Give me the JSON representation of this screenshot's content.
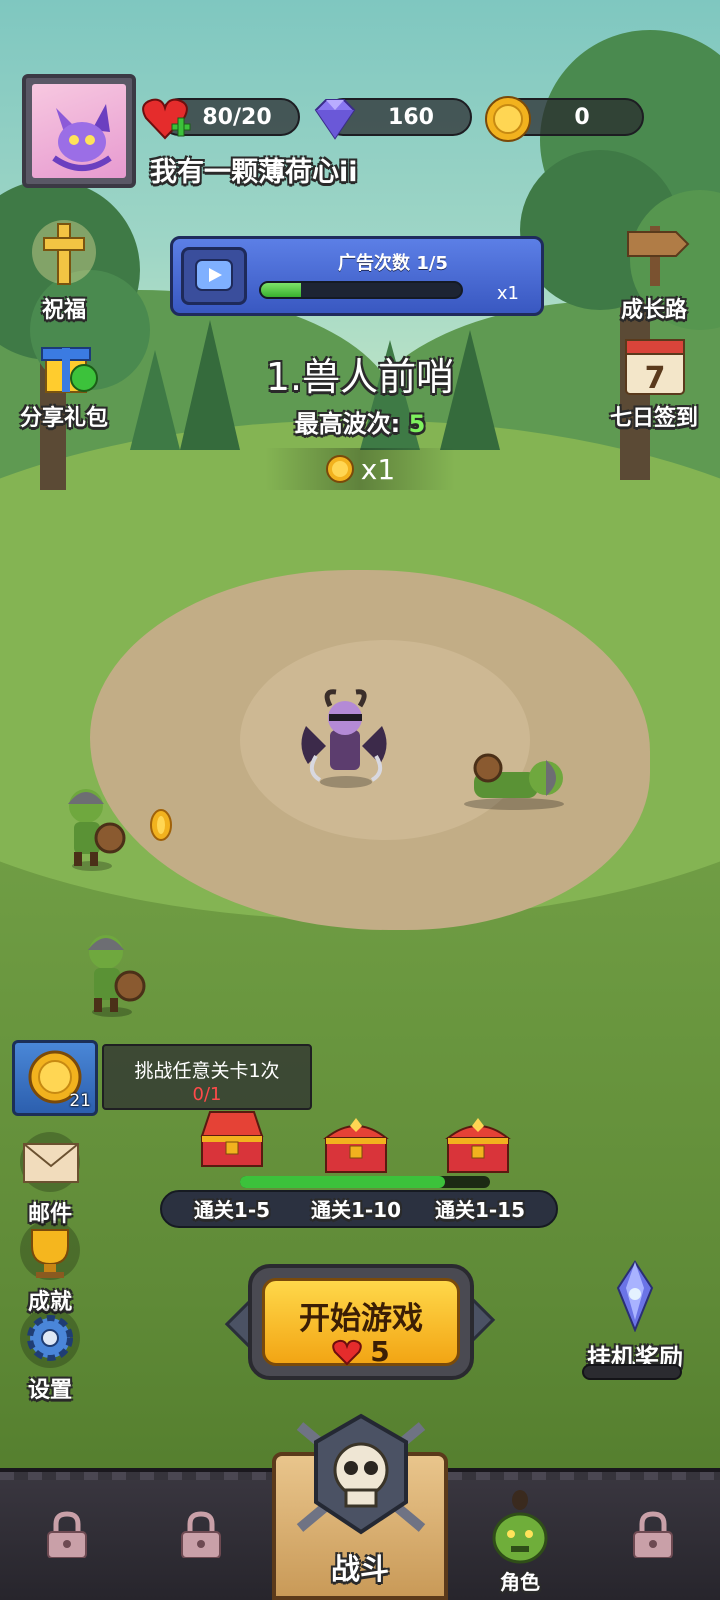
{
  "player": {
    "name": "我有一颗薄荷心ii",
    "avatar_icon": "purple-bat-mage-avatar"
  },
  "resources": {
    "stamina": "80/20",
    "gems": "160",
    "coins": "0"
  },
  "left_menu": {
    "blessing": "祝福",
    "share_gift": "分享礼包",
    "mail": "邮件",
    "achievements": "成就",
    "settings": "设置"
  },
  "right_menu": {
    "growth_path": "成长路",
    "seven_day_signin": "七日签到",
    "seven_day_number": "7",
    "idle_reward": "挂机奖励"
  },
  "ad_panel": {
    "title": "广告次数 1/5",
    "multiplier": "x1",
    "progress_fraction": 0.2
  },
  "level": {
    "name": "1.兽人前哨",
    "best_wave_label": "最高波次:",
    "best_wave_value": "5",
    "coin_multiplier": "x1"
  },
  "task": {
    "text": "挑战任意关卡1次",
    "progress": "0/1",
    "reward_count": "21"
  },
  "milestones": [
    {
      "label": "通关1-5",
      "state": "opened"
    },
    {
      "label": "通关1-10",
      "state": "closed"
    },
    {
      "label": "通关1-15",
      "state": "closed"
    }
  ],
  "start_button": {
    "label": "开始游戏",
    "cost": "5"
  },
  "bottom_nav": {
    "battle": "战斗",
    "role": "角色"
  },
  "colors": {
    "accent_yellow": "#f2a514",
    "progress_green": "#39b02e",
    "task_progress_red": "#ff4a4a",
    "best_wave_green": "#7ef05e"
  }
}
